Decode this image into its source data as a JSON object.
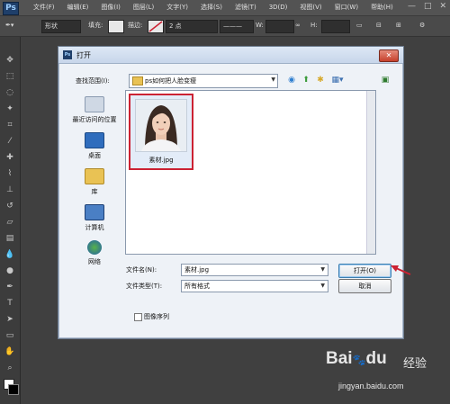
{
  "app": {
    "logo": "Ps"
  },
  "menubar": {
    "items": [
      "文件(F)",
      "编辑(E)",
      "图像(I)",
      "图层(L)",
      "文字(Y)",
      "选择(S)",
      "滤镜(T)",
      "3D(D)",
      "视图(V)",
      "窗口(W)",
      "帮助(H)"
    ]
  },
  "window_controls": [
    "—",
    "□",
    "✕"
  ],
  "options_bar": {
    "mode_value": "形状",
    "fill_label": "填充:",
    "stroke_label": "描边:",
    "stroke_width": "2 点",
    "w_label": "W:",
    "h_label": "H:"
  },
  "dialog": {
    "title": "打开",
    "title_icon": "Ps",
    "look_in_label": "查找范围(I):",
    "look_in_value": "ps如何把人脸变瘦",
    "places": [
      {
        "label": "最近访问的位置",
        "icon": "recent-places-icon"
      },
      {
        "label": "桌面",
        "icon": "desktop-icon"
      },
      {
        "label": "库",
        "icon": "libraries-icon"
      },
      {
        "label": "计算机",
        "icon": "computer-icon"
      },
      {
        "label": "网络",
        "icon": "network-icon"
      }
    ],
    "file": {
      "name": "素材.jpg"
    },
    "filename_label": "文件名(N):",
    "filename_value": "素材.jpg",
    "filetype_label": "文件类型(T):",
    "filetype_value": "所有格式",
    "open_button": "打开(O)",
    "cancel_button": "取消",
    "image_sequence_label": "图像序列"
  },
  "watermark": {
    "logo": "Bai",
    "paw": "du",
    "suffix": "经验",
    "url": "jingyan.baidu.com"
  },
  "colors": {
    "annotation_red": "#cc2233",
    "ps_bg": "#404040"
  }
}
